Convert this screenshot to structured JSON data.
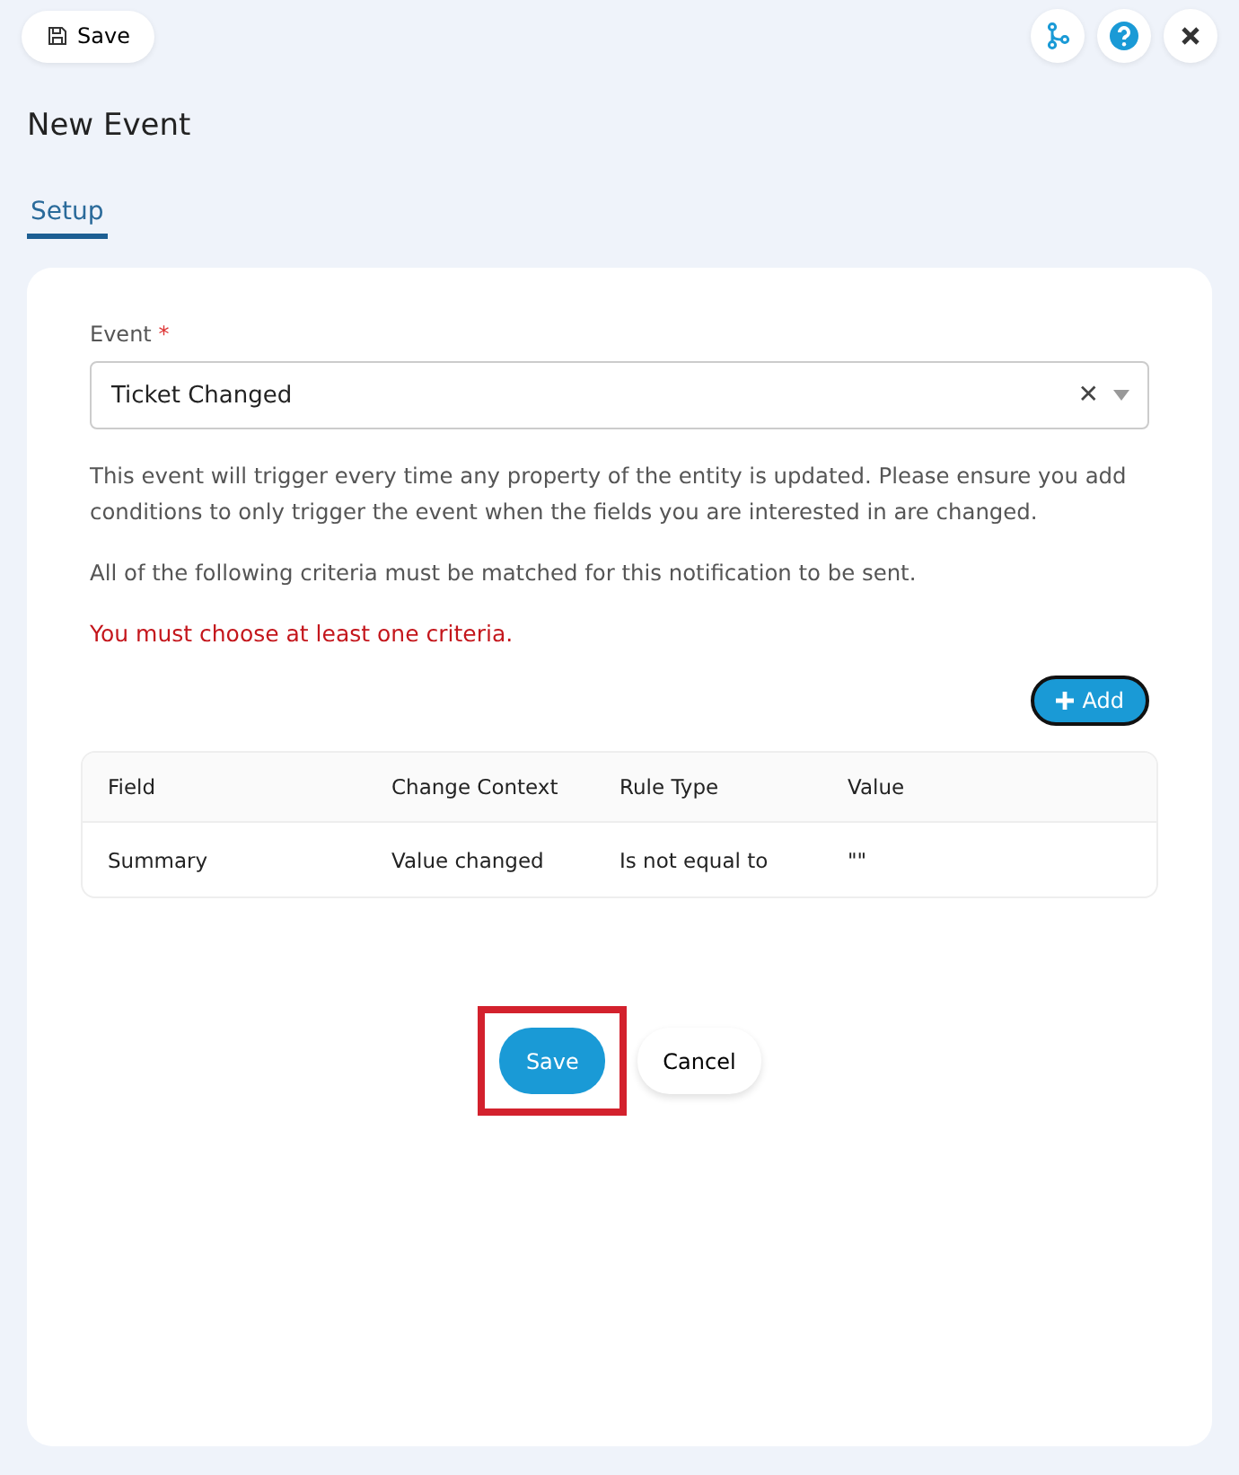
{
  "toolbar": {
    "save_label": "Save"
  },
  "title": "New Event",
  "tabs": [
    {
      "label": "Setup",
      "selected": true
    }
  ],
  "form": {
    "event_label": "Event",
    "required_mark": "*",
    "event_value": "Ticket Changed",
    "clear_glyph": "✕",
    "description": "This event will trigger every time any property of the entity is updated. Please ensure you add conditions to only trigger the event when the fields you are interested in are changed.",
    "criteria_note": "All of the following criteria must be matched for this notification to be sent.",
    "error": "You must choose at least one criteria.",
    "add_label": "Add"
  },
  "table": {
    "columns": [
      "Field",
      "Change Context",
      "Rule Type",
      "Value"
    ],
    "rows": [
      [
        "Summary",
        "Value changed",
        "Is not equal to",
        "\"\""
      ]
    ]
  },
  "actions": {
    "save": "Save",
    "cancel": "Cancel",
    "save_highlighted": true
  }
}
